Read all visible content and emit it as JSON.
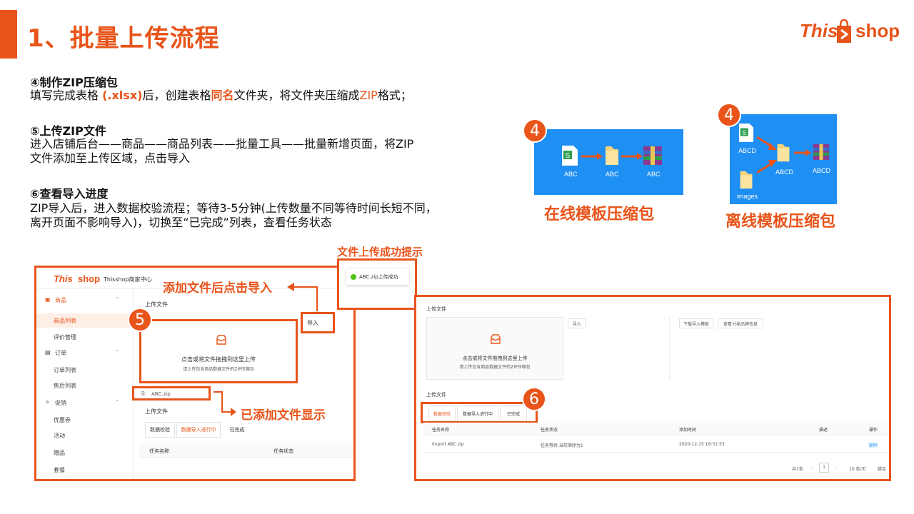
{
  "title": "1、批量上传流程",
  "logo": {
    "part1": "This",
    "part2": "shop"
  },
  "steps": [
    {
      "heading": "④制作ZIP压缩包",
      "text_a": "填写完成表格 ",
      "text_hl1": "(.xlsx)",
      "text_b": "后，创建表格",
      "text_hl2": "同名",
      "text_c": "文件夹，将文件夹压缩成",
      "text_hl3": "ZIP",
      "text_d": "格式；"
    },
    {
      "heading": "⑤上传ZIP文件",
      "text_line1": "进入店铺后台——商品——商品列表——批量工具——批量新增页面，将ZIP",
      "text_line2": "文件添加至上传区域，点击导入"
    },
    {
      "heading": "⑥查看导入进度",
      "text_line1": "ZIP导入后，进入数据校验流程；等待3-5分钟(上传数量不同等待时间长短不同，",
      "text_line2": "离开页面不影响导入)，切换至“已完成”列表，查看任务状态"
    }
  ],
  "figures": {
    "online": {
      "badge": "4",
      "caption": "在线模板压缩包",
      "files": [
        "ABC",
        "ABC",
        "ABC"
      ]
    },
    "offline": {
      "badge": "4",
      "caption": "离线模板压缩包",
      "files": [
        "ABCD",
        "images",
        "ABCD",
        "ABCD"
      ]
    }
  },
  "annotations": {
    "upload_success": "文件上传成功提示",
    "click_import": "添加文件后点击导入",
    "file_added": "已添加文件显示"
  },
  "left_panel": {
    "brand": "Thisshop商家中心",
    "logo_part1": "This",
    "logo_part2": "shop",
    "sidebar": [
      {
        "label": "商品",
        "type": "group"
      },
      {
        "label": "商品列表",
        "type": "item",
        "active": true
      },
      {
        "label": "评价管理",
        "type": "item"
      },
      {
        "label": "订单",
        "type": "group"
      },
      {
        "label": "订单列表",
        "type": "item"
      },
      {
        "label": "售后列表",
        "type": "item"
      },
      {
        "label": "促销",
        "type": "group"
      },
      {
        "label": "优惠券",
        "type": "item"
      },
      {
        "label": "活动",
        "type": "item"
      },
      {
        "label": "赠品",
        "type": "item"
      },
      {
        "label": "套餐",
        "type": "item"
      }
    ],
    "upload_section": "上传文件",
    "badge": "5",
    "import_button": "导入",
    "drop_line1": "点击或将文件拖拽到这里上传",
    "drop_line2": "请上传包含商品数据文件的ZIP压缩包",
    "added_file": "ABC.zip",
    "upload_section2": "上传文件",
    "tabs": [
      "数据校验",
      "数据导入进行中",
      "已完成"
    ],
    "columns": [
      "任务名称",
      "任务状态"
    ]
  },
  "toast": {
    "text": "ABC.zip上传成功"
  },
  "right_panel": {
    "upload_section": "上传文件",
    "import_button": "导入",
    "download_button": "下载导入模板",
    "brand_button": "查看分类品牌信息",
    "drop_line1": "点击或将文件拖拽到这里上传",
    "drop_line2": "请上传包含商品数据文件的ZIP压缩包",
    "upload_section2": "上传文件",
    "badge": "6",
    "tabs": [
      "数据校验",
      "数据导入进行中",
      "已完成"
    ],
    "columns": [
      "任务名称",
      "任务状态",
      "添加时间",
      "描述",
      "操作"
    ],
    "row": {
      "name": "Import ABC.zip",
      "status": "任务等待,当前顺序为1",
      "time": "2020-12-15 16:31:53",
      "desc": "",
      "action": "删除"
    },
    "pagination": {
      "total": "共1条",
      "page": "1",
      "per_page": "10 条/页",
      "goto": "跳至"
    }
  },
  "colors": {
    "accent": "#e8541a",
    "figure_bg": "#1e8ff3",
    "success": "#52c41a"
  }
}
